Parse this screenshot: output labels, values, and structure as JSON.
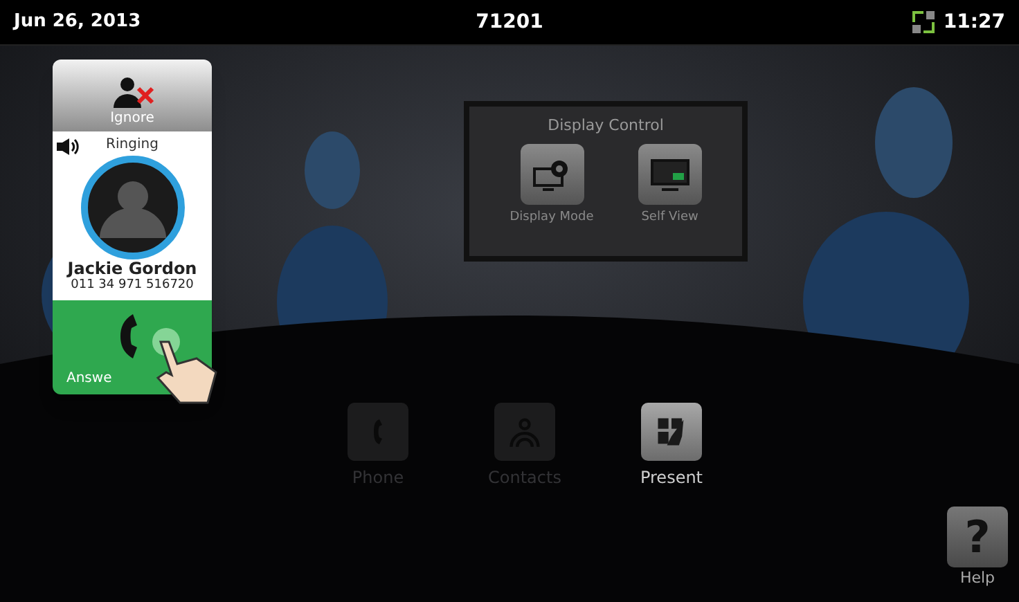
{
  "status_bar": {
    "date": "Jun 26, 2013",
    "extension": "71201",
    "time": "11:27"
  },
  "incoming_call": {
    "ignore_label": "Ignore",
    "status": "Ringing",
    "name": "Jackie Gordon",
    "number": "011 34 971 516720",
    "answer_label": "Answe"
  },
  "display_control": {
    "title": "Display Control",
    "items": [
      {
        "kind": "mode",
        "label": "Display Mode"
      },
      {
        "kind": "selfview",
        "label": "Self View"
      }
    ]
  },
  "dock": [
    {
      "kind": "phone",
      "label": "Phone",
      "disabled": true
    },
    {
      "kind": "contacts",
      "label": "Contacts",
      "disabled": true
    },
    {
      "kind": "present",
      "label": "Present",
      "disabled": false
    }
  ],
  "help": {
    "glyph": "?",
    "label": "Help"
  }
}
